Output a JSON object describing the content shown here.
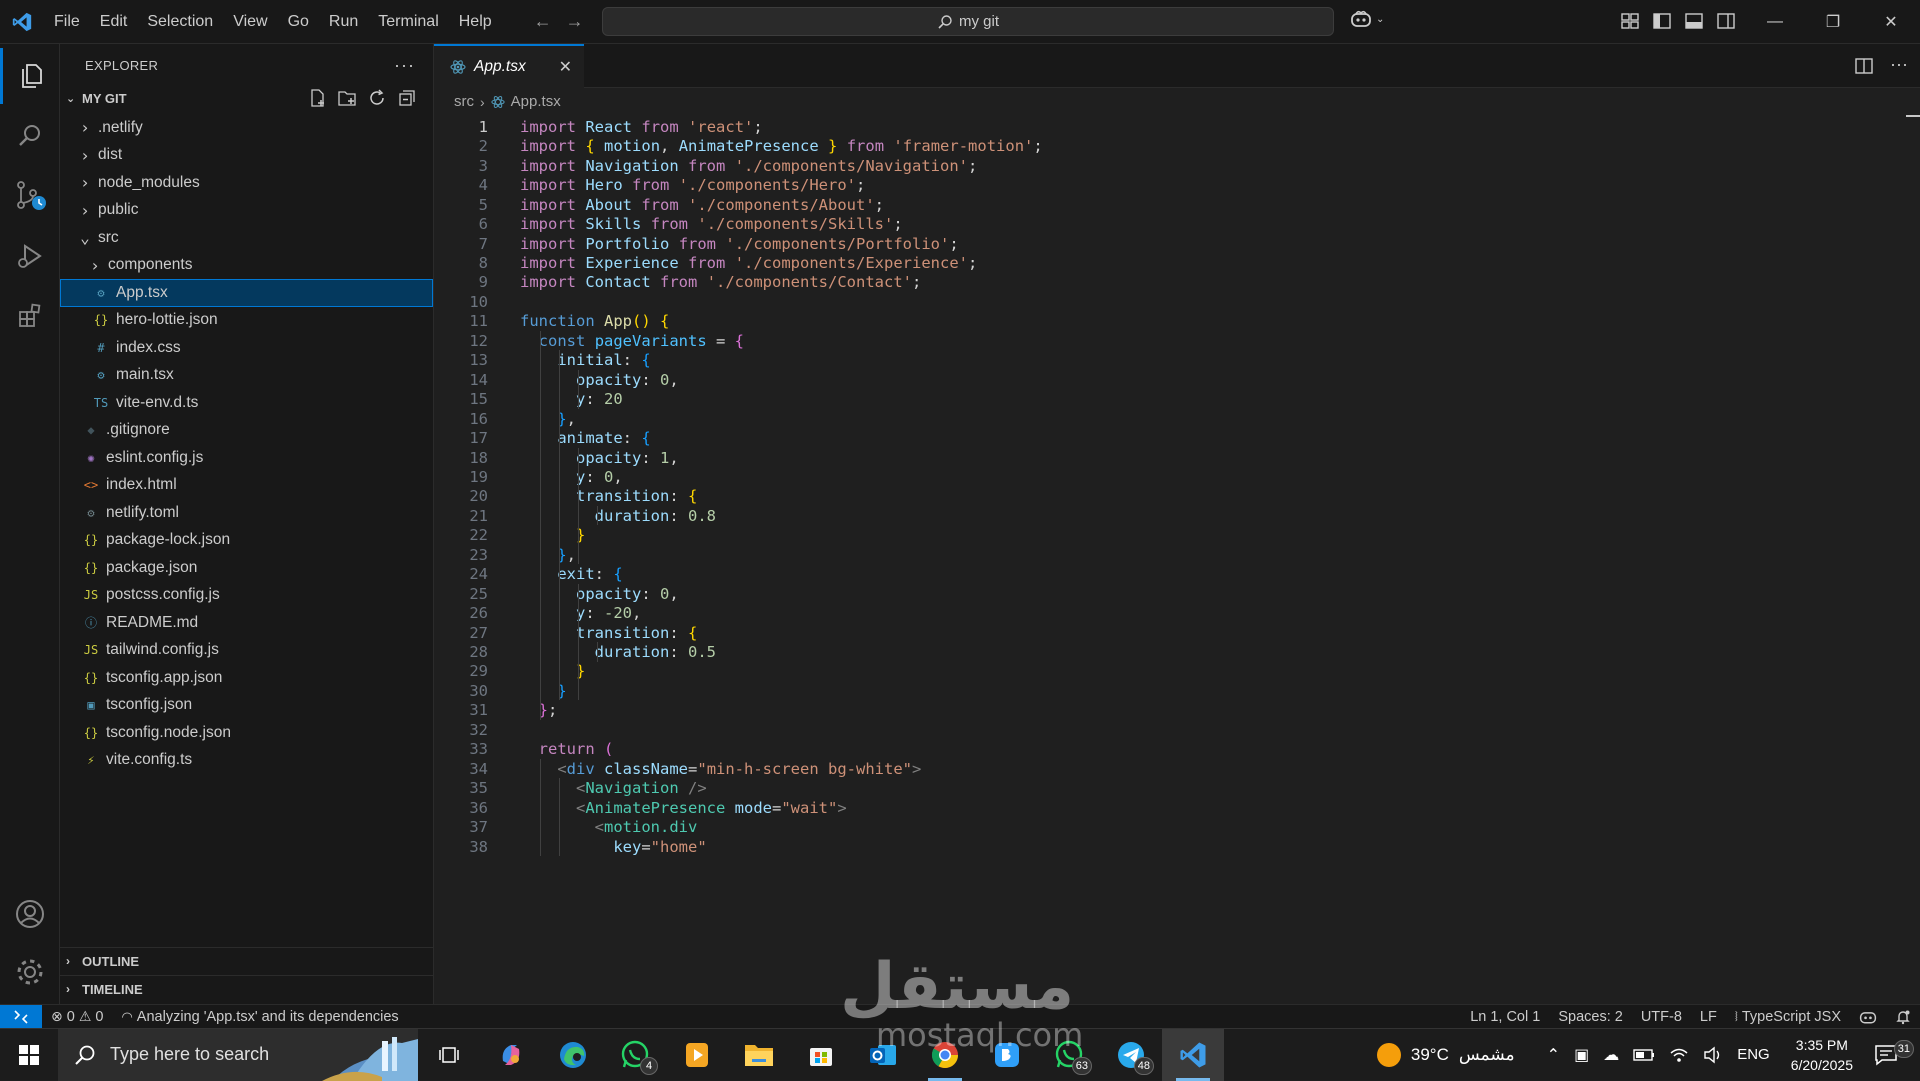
{
  "titlebar": {
    "menu": [
      "File",
      "Edit",
      "Selection",
      "View",
      "Go",
      "Run",
      "Terminal",
      "Help"
    ],
    "search_text": "my git"
  },
  "sidebar": {
    "title": "EXPLORER",
    "root_label": "MY GIT",
    "tree": [
      {
        "label": ".netlify",
        "kind": "folder",
        "level": 0
      },
      {
        "label": "dist",
        "kind": "folder",
        "level": 0
      },
      {
        "label": "node_modules",
        "kind": "folder",
        "level": 0
      },
      {
        "label": "public",
        "kind": "folder",
        "level": 0
      },
      {
        "label": "src",
        "kind": "folder-open",
        "level": 0
      },
      {
        "label": "components",
        "kind": "folder",
        "level": 1
      },
      {
        "label": "App.tsx",
        "kind": "react",
        "level": 1,
        "selected": true
      },
      {
        "label": "hero-lottie.json",
        "kind": "json",
        "level": 1
      },
      {
        "label": "index.css",
        "kind": "css",
        "level": 1
      },
      {
        "label": "main.tsx",
        "kind": "react",
        "level": 1
      },
      {
        "label": "vite-env.d.ts",
        "kind": "ts",
        "level": 1
      },
      {
        "label": ".gitignore",
        "kind": "git",
        "level": 0
      },
      {
        "label": "eslint.config.js",
        "kind": "eslint",
        "level": 0
      },
      {
        "label": "index.html",
        "kind": "html",
        "level": 0
      },
      {
        "label": "netlify.toml",
        "kind": "gear",
        "level": 0
      },
      {
        "label": "package-lock.json",
        "kind": "json",
        "level": 0
      },
      {
        "label": "package.json",
        "kind": "json",
        "level": 0
      },
      {
        "label": "postcss.config.js",
        "kind": "js",
        "level": 0
      },
      {
        "label": "README.md",
        "kind": "info",
        "level": 0
      },
      {
        "label": "tailwind.config.js",
        "kind": "js",
        "level": 0
      },
      {
        "label": "tsconfig.app.json",
        "kind": "json",
        "level": 0
      },
      {
        "label": "tsconfig.json",
        "kind": "tsconfig",
        "level": 0
      },
      {
        "label": "tsconfig.node.json",
        "kind": "json",
        "level": 0
      },
      {
        "label": "vite.config.ts",
        "kind": "vite",
        "level": 0
      }
    ],
    "outline_label": "OUTLINE",
    "timeline_label": "TIMELINE"
  },
  "editor": {
    "tab_label": "App.tsx",
    "breadcrumb": [
      "src",
      "App.tsx"
    ],
    "current_line": 1,
    "lines": [
      [
        [
          "k",
          "import"
        ],
        [
          "p",
          " "
        ],
        [
          "v",
          "React"
        ],
        [
          "p",
          " "
        ],
        [
          "k",
          "from"
        ],
        [
          "p",
          " "
        ],
        [
          "s",
          "'react'"
        ],
        [
          "p",
          ";"
        ]
      ],
      [
        [
          "k",
          "import"
        ],
        [
          "p",
          " "
        ],
        [
          "b1",
          "{"
        ],
        [
          "p",
          " "
        ],
        [
          "v",
          "motion"
        ],
        [
          "p",
          ", "
        ],
        [
          "v",
          "AnimatePresence"
        ],
        [
          "p",
          " "
        ],
        [
          "b1",
          "}"
        ],
        [
          "p",
          " "
        ],
        [
          "k",
          "from"
        ],
        [
          "p",
          " "
        ],
        [
          "s",
          "'framer-motion'"
        ],
        [
          "p",
          ";"
        ]
      ],
      [
        [
          "k",
          "import"
        ],
        [
          "p",
          " "
        ],
        [
          "v",
          "Navigation"
        ],
        [
          "p",
          " "
        ],
        [
          "k",
          "from"
        ],
        [
          "p",
          " "
        ],
        [
          "s",
          "'./components/Navigation'"
        ],
        [
          "p",
          ";"
        ]
      ],
      [
        [
          "k",
          "import"
        ],
        [
          "p",
          " "
        ],
        [
          "v",
          "Hero"
        ],
        [
          "p",
          " "
        ],
        [
          "k",
          "from"
        ],
        [
          "p",
          " "
        ],
        [
          "s",
          "'./components/Hero'"
        ],
        [
          "p",
          ";"
        ]
      ],
      [
        [
          "k",
          "import"
        ],
        [
          "p",
          " "
        ],
        [
          "v",
          "About"
        ],
        [
          "p",
          " "
        ],
        [
          "k",
          "from"
        ],
        [
          "p",
          " "
        ],
        [
          "s",
          "'./components/About'"
        ],
        [
          "p",
          ";"
        ]
      ],
      [
        [
          "k",
          "import"
        ],
        [
          "p",
          " "
        ],
        [
          "v",
          "Skills"
        ],
        [
          "p",
          " "
        ],
        [
          "k",
          "from"
        ],
        [
          "p",
          " "
        ],
        [
          "s",
          "'./components/Skills'"
        ],
        [
          "p",
          ";"
        ]
      ],
      [
        [
          "k",
          "import"
        ],
        [
          "p",
          " "
        ],
        [
          "v",
          "Portfolio"
        ],
        [
          "p",
          " "
        ],
        [
          "k",
          "from"
        ],
        [
          "p",
          " "
        ],
        [
          "s",
          "'./components/Portfolio'"
        ],
        [
          "p",
          ";"
        ]
      ],
      [
        [
          "k",
          "import"
        ],
        [
          "p",
          " "
        ],
        [
          "v",
          "Experience"
        ],
        [
          "p",
          " "
        ],
        [
          "k",
          "from"
        ],
        [
          "p",
          " "
        ],
        [
          "s",
          "'./components/Experience'"
        ],
        [
          "p",
          ";"
        ]
      ],
      [
        [
          "k",
          "import"
        ],
        [
          "p",
          " "
        ],
        [
          "v",
          "Contact"
        ],
        [
          "p",
          " "
        ],
        [
          "k",
          "from"
        ],
        [
          "p",
          " "
        ],
        [
          "s",
          "'./components/Contact'"
        ],
        [
          "p",
          ";"
        ]
      ],
      [],
      [
        [
          "kb",
          "function"
        ],
        [
          "p",
          " "
        ],
        [
          "f",
          "App"
        ],
        [
          "b1",
          "()"
        ],
        [
          "p",
          " "
        ],
        [
          "b1",
          "{"
        ]
      ],
      [
        [
          "p",
          "  "
        ],
        [
          "kb",
          "const"
        ],
        [
          "p",
          " "
        ],
        [
          "c",
          "pageVariants"
        ],
        [
          "p",
          " = "
        ],
        [
          "b2",
          "{"
        ]
      ],
      [
        [
          "p",
          "    "
        ],
        [
          "v",
          "initial"
        ],
        [
          "p",
          ": "
        ],
        [
          "b3",
          "{"
        ]
      ],
      [
        [
          "p",
          "      "
        ],
        [
          "v",
          "opacity"
        ],
        [
          "p",
          ": "
        ],
        [
          "n",
          "0"
        ],
        [
          "p",
          ","
        ]
      ],
      [
        [
          "p",
          "      "
        ],
        [
          "v",
          "y"
        ],
        [
          "p",
          ": "
        ],
        [
          "n",
          "20"
        ]
      ],
      [
        [
          "p",
          "    "
        ],
        [
          "b3",
          "}"
        ],
        [
          "p",
          ","
        ]
      ],
      [
        [
          "p",
          "    "
        ],
        [
          "v",
          "animate"
        ],
        [
          "p",
          ": "
        ],
        [
          "b3",
          "{"
        ]
      ],
      [
        [
          "p",
          "      "
        ],
        [
          "v",
          "opacity"
        ],
        [
          "p",
          ": "
        ],
        [
          "n",
          "1"
        ],
        [
          "p",
          ","
        ]
      ],
      [
        [
          "p",
          "      "
        ],
        [
          "v",
          "y"
        ],
        [
          "p",
          ": "
        ],
        [
          "n",
          "0"
        ],
        [
          "p",
          ","
        ]
      ],
      [
        [
          "p",
          "      "
        ],
        [
          "v",
          "transition"
        ],
        [
          "p",
          ": "
        ],
        [
          "b1",
          "{"
        ]
      ],
      [
        [
          "p",
          "        "
        ],
        [
          "v",
          "duration"
        ],
        [
          "p",
          ": "
        ],
        [
          "n",
          "0.8"
        ]
      ],
      [
        [
          "p",
          "      "
        ],
        [
          "b1",
          "}"
        ]
      ],
      [
        [
          "p",
          "    "
        ],
        [
          "b3",
          "}"
        ],
        [
          "p",
          ","
        ]
      ],
      [
        [
          "p",
          "    "
        ],
        [
          "v",
          "exit"
        ],
        [
          "p",
          ": "
        ],
        [
          "b3",
          "{"
        ]
      ],
      [
        [
          "p",
          "      "
        ],
        [
          "v",
          "opacity"
        ],
        [
          "p",
          ": "
        ],
        [
          "n",
          "0"
        ],
        [
          "p",
          ","
        ]
      ],
      [
        [
          "p",
          "      "
        ],
        [
          "v",
          "y"
        ],
        [
          "p",
          ": "
        ],
        [
          "n",
          "-20"
        ],
        [
          "p",
          ","
        ]
      ],
      [
        [
          "p",
          "      "
        ],
        [
          "v",
          "transition"
        ],
        [
          "p",
          ": "
        ],
        [
          "b1",
          "{"
        ]
      ],
      [
        [
          "p",
          "        "
        ],
        [
          "v",
          "duration"
        ],
        [
          "p",
          ": "
        ],
        [
          "n",
          "0.5"
        ]
      ],
      [
        [
          "p",
          "      "
        ],
        [
          "b1",
          "}"
        ]
      ],
      [
        [
          "p",
          "    "
        ],
        [
          "b3",
          "}"
        ]
      ],
      [
        [
          "p",
          "  "
        ],
        [
          "b2",
          "}"
        ],
        [
          "p",
          ";"
        ]
      ],
      [],
      [
        [
          "p",
          "  "
        ],
        [
          "k",
          "return"
        ],
        [
          "p",
          " "
        ],
        [
          "b2",
          "("
        ]
      ],
      [
        [
          "p",
          "    "
        ],
        [
          "tg",
          "<"
        ],
        [
          "kb",
          "div"
        ],
        [
          "p",
          " "
        ],
        [
          "v",
          "className"
        ],
        [
          "p",
          "="
        ],
        [
          "s",
          "\"min-h-screen bg-white\""
        ],
        [
          "tg",
          ">"
        ]
      ],
      [
        [
          "p",
          "      "
        ],
        [
          "tg",
          "<"
        ],
        [
          "t",
          "Navigation"
        ],
        [
          "p",
          " "
        ],
        [
          "tg",
          "/>"
        ]
      ],
      [
        [
          "p",
          "      "
        ],
        [
          "tg",
          "<"
        ],
        [
          "t",
          "AnimatePresence"
        ],
        [
          "p",
          " "
        ],
        [
          "v",
          "mode"
        ],
        [
          "p",
          "="
        ],
        [
          "s",
          "\"wait\""
        ],
        [
          "tg",
          ">"
        ]
      ],
      [
        [
          "p",
          "        "
        ],
        [
          "tg",
          "<"
        ],
        [
          "t",
          "motion.div"
        ]
      ],
      [
        [
          "p",
          "          "
        ],
        [
          "v",
          "key"
        ],
        [
          "p",
          "="
        ],
        [
          "s",
          "\"home\""
        ]
      ]
    ]
  },
  "statusbar": {
    "errors": "0",
    "warnings": "0",
    "task": "Analyzing 'App.tsx' and its dependencies",
    "position": "Ln 1, Col 1",
    "spaces": "Spaces: 2",
    "encoding": "UTF-8",
    "eol": "LF",
    "language": "TypeScript JSX"
  },
  "taskbar": {
    "search_placeholder": "Type here to search",
    "whatsapp_badge": "4",
    "whatsapp2_badge": "63",
    "telegram_badge": "48",
    "weather": "39°C",
    "weather_desc": "مشمس",
    "lang": "ENG",
    "time": "3:35 PM",
    "date": "6/20/2025",
    "notifications": "31"
  },
  "watermark": {
    "text": "مستقل",
    "url": "mostaql.com"
  },
  "colors": {
    "accent": "#0078d4",
    "selection": "#04395e",
    "background": "#1f1f1f",
    "chrome": "#181818"
  }
}
